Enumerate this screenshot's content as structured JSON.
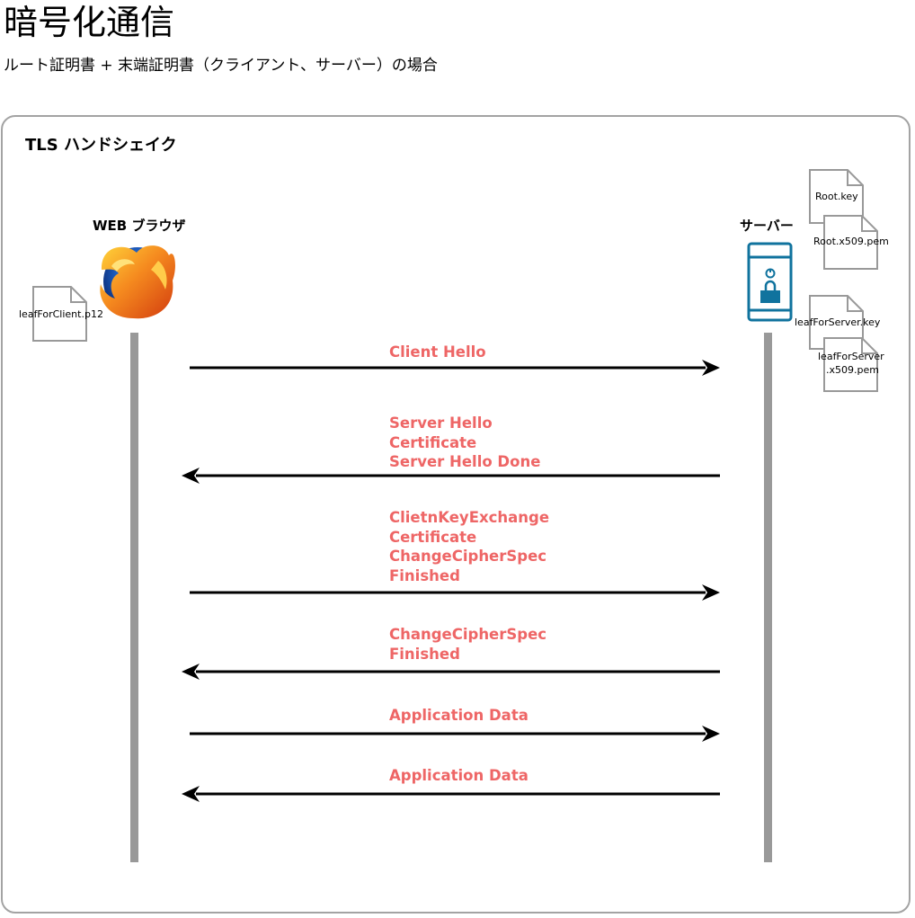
{
  "page": {
    "title": "暗号化通信",
    "subtitle": "ルート証明書 + 末端証明書（クライアント、サーバー）の場合"
  },
  "diagram": {
    "frame_title": "TLS ハンドシェイク",
    "actors": {
      "client_label": "WEB ブラウザ",
      "server_label": "サーバー"
    },
    "client_files": [
      "leafForClient.p12"
    ],
    "server_files": {
      "root_key": "Root.key",
      "root_cert": "Root.x509.pem",
      "leaf_key": "leafForServer.key",
      "leaf_cert_line1": "leafForServer",
      "leaf_cert_line2": ".x509.pem"
    },
    "messages": [
      {
        "direction": "to-server",
        "lines": [
          "Client Hello"
        ]
      },
      {
        "direction": "to-client",
        "lines": [
          "Server Hello",
          "Certificate",
          "Server Hello Done"
        ]
      },
      {
        "direction": "to-server",
        "lines": [
          "ClietnKeyExchange",
          "Certificate",
          "ChangeCipherSpec",
          "Finished"
        ]
      },
      {
        "direction": "to-client",
        "lines": [
          "ChangeCipherSpec",
          "Finished"
        ]
      },
      {
        "direction": "to-server",
        "lines": [
          "Application Data"
        ]
      },
      {
        "direction": "to-client",
        "lines": [
          "Application Data"
        ]
      }
    ],
    "colors": {
      "message_text": "#ee6666",
      "lifeline": "#999999",
      "arrow": "#000000",
      "frame_border": "#a3a3a3",
      "server_icon": "#10739e",
      "file_icon_stroke": "#999999"
    },
    "icons": {
      "client": "firefox-browser-icon",
      "server": "secure-server-icon",
      "file": "document-icon"
    }
  }
}
